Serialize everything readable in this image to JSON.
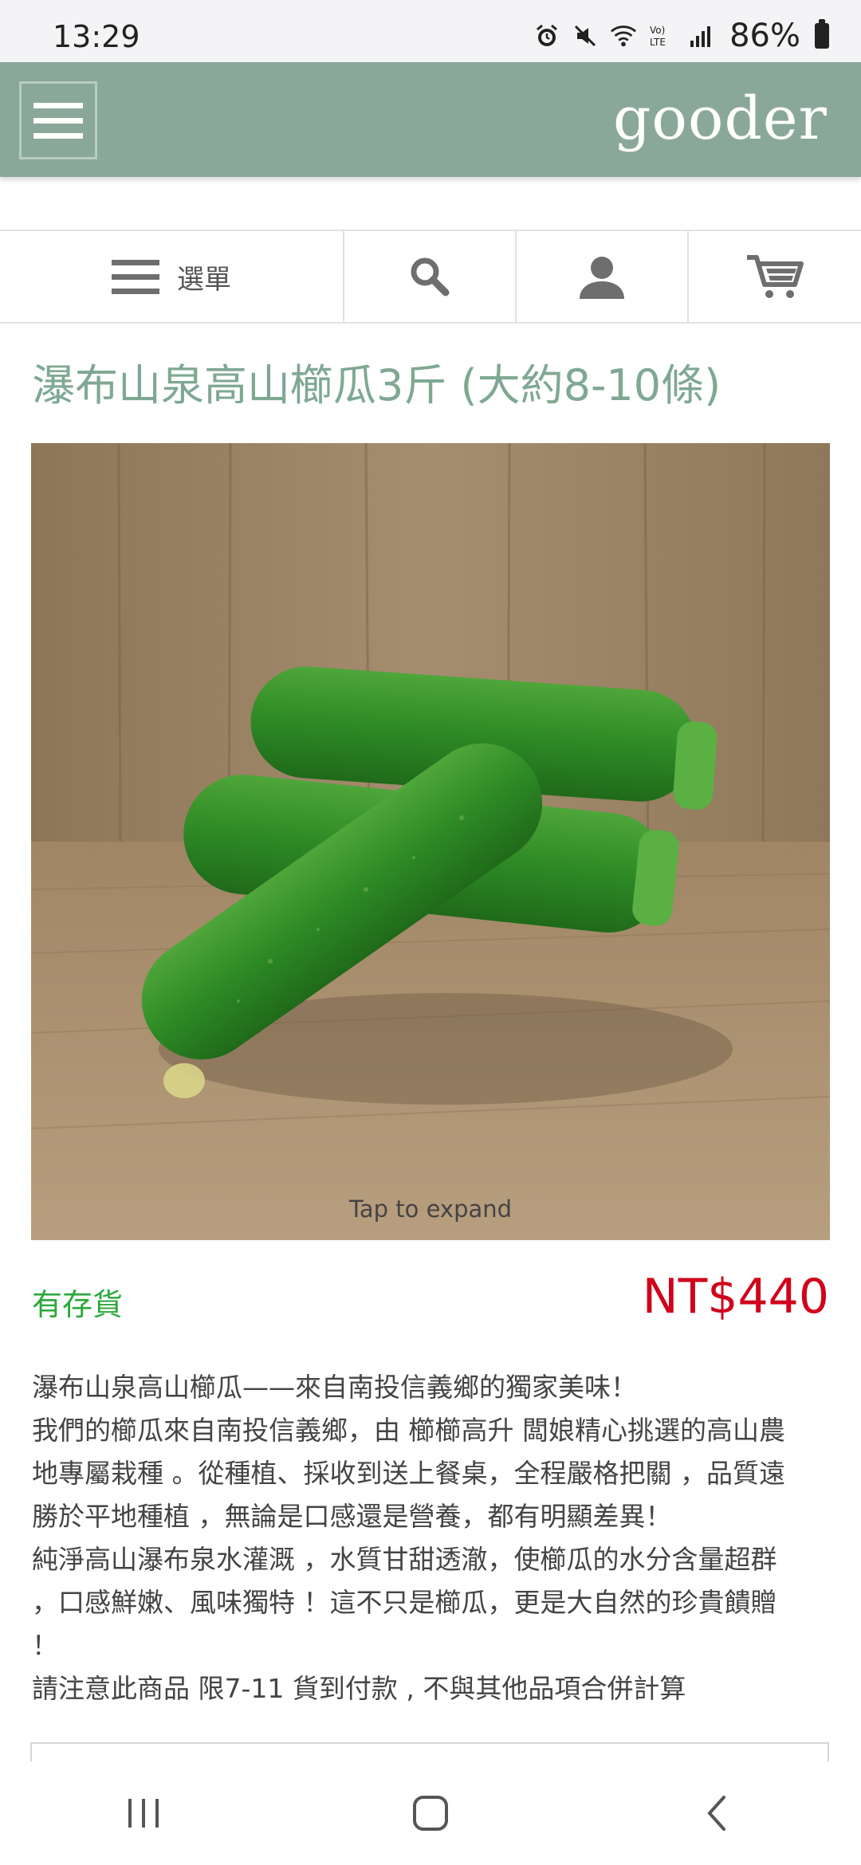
{
  "status_bar": {
    "time": "13:29",
    "battery": "86%",
    "icons": [
      "alarm-icon",
      "mute-icon",
      "wifi-icon",
      "volte-icon",
      "signal-icon",
      "battery-icon"
    ]
  },
  "header": {
    "brand": "gooder",
    "menu_icon": "hamburger-icon",
    "background_color": "#8aa89a"
  },
  "nav": {
    "menu_label": "選單",
    "items": [
      "menu-icon",
      "search-icon",
      "user-icon",
      "cart-icon"
    ]
  },
  "product": {
    "title": "瀑布山泉高山櫛瓜3斤 (大約8-10條)",
    "image_hint": "Tap to expand",
    "stock": "有存貨",
    "price": "NT$440",
    "description_lines": [
      "瀑布山泉高山櫛瓜——來自南投信義鄉的獨家美味！",
      "我們的櫛瓜來自南投信義鄉，由 櫛櫛高升 闆娘精心挑選的高山農",
      "地專屬栽種 。從種植、採收到送上餐桌，全程嚴格把關 ，品質遠",
      "勝於平地種植 ，無論是口感還是營養，都有明顯差異！",
      "純淨高山瀑布泉水灌溉 ，水質甘甜透澈，使櫛瓜的水分含量超群",
      "，口感鮮嫩、風味獨特 ！這不只是櫛瓜，更是大自然的珍貴饋贈",
      "！",
      "請注意此商品 限7-11 貨到付款 , 不與其他品項合併計算"
    ]
  },
  "colors": {
    "title": "#7fa892",
    "stock": "#2aa83a",
    "price": "#d0021b"
  },
  "system_nav": [
    "recents-icon",
    "home-icon",
    "back-icon"
  ]
}
